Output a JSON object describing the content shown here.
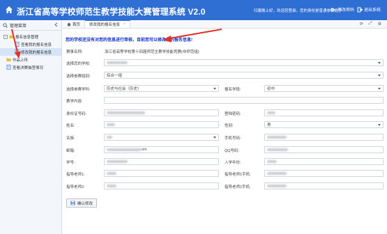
{
  "header": {
    "title": "浙江省高等学校师范生教学技能大赛管理系统 V2.0",
    "welcome": "您的身份是普通参赛选手",
    "welcome_prefix": "归属晚上好，欢迎您登录。",
    "change_password": "修改密码",
    "logout": "退出系统",
    "bg_color": "#2f6fd3"
  },
  "sidebar": {
    "title": "管理菜单",
    "items": [
      {
        "label": "报名信息管理",
        "level": 0,
        "icon": "folder-icon"
      },
      {
        "label": "查看我的报名信息",
        "level": 1,
        "icon": "document-icon"
      },
      {
        "label": "修改我的报名信息",
        "level": 1,
        "icon": "document-icon",
        "active": true
      },
      {
        "label": "作品上传",
        "level": 0,
        "icon": "folder-icon"
      },
      {
        "label": "查看决赛抽签情况",
        "level": 0,
        "icon": "document-icon"
      }
    ]
  },
  "tabs": [
    {
      "label": "首页",
      "icon": "home-icon"
    },
    {
      "label": "修改我的报名信息",
      "active": true,
      "close": "×"
    }
  ],
  "notice": "您的学校还没有对您的信息进行审核，目前您可以修改您的报名信息!",
  "form": {
    "competition_label": "赛事名称:",
    "competition_value": "浙江省高等学校第十四届师范生教学技能竞赛(非师范组)",
    "school_label": "选择您的学校:",
    "category_label": "选择参赛组别:",
    "category_value": "综合一组",
    "subject_label": "选择参赛学科:",
    "subject_value": "历史与社会（历史）",
    "level_label": "报名学段:",
    "level_value": "初中",
    "content_label": "教学内容:",
    "id_label": "身份证号码:",
    "password_label": "登陆密码:",
    "name_label": "姓名:",
    "gender_label": "性别:",
    "gender_value": "男",
    "ethnicity_label": "名族:",
    "phone_label": "手机号码:",
    "email_label": "邮箱:",
    "email_value_suffix": "om",
    "qq_label": "QQ号码:",
    "student_id_label": "学号:",
    "enroll_year_label": "入学年份:",
    "teacher1_label": "指导老师1:",
    "teacher1_phone_label": "指导老师1手机:",
    "teacher2_label": "指导老师2:",
    "teacher2_phone_label": "指导老师2手机:",
    "confirm_button": "确认修改"
  },
  "colors": {
    "notice": "#1030c8",
    "arrow": "#e0302a",
    "active_item_bg": "#d6e4f7"
  }
}
